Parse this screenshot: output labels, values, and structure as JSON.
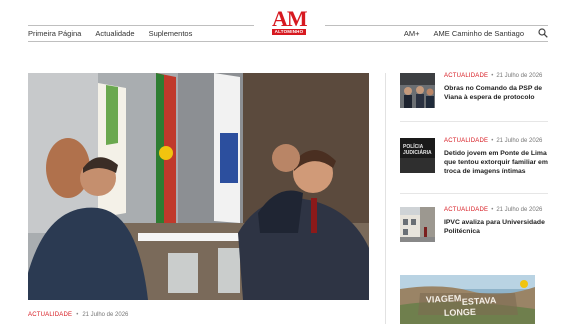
{
  "header": {
    "nav_left": [
      "Primeira Página",
      "Actualidade",
      "Suplementos"
    ],
    "nav_right": [
      "AM+",
      "AME Caminho de Santiago"
    ],
    "logo_text": "AM",
    "logo_sub": "ALTOMINHO",
    "search_icon": "search-icon"
  },
  "featured": {
    "category": "ACTUALIDADE",
    "separator": "•",
    "date": "21 Julho de 2026"
  },
  "side_items": [
    {
      "category": "ACTUALIDADE",
      "separator": "•",
      "date": "21 Julho de 2026",
      "title": "Obras no Comando da PSP de Viana à espera de protocolo"
    },
    {
      "category": "ACTUALIDADE",
      "separator": "•",
      "date": "21 Julho de 2026",
      "title": "Detido jovem em Ponte de Lima que tentou extorquir familiar em troca de imagens íntimas"
    },
    {
      "category": "ACTUALIDADE",
      "separator": "•",
      "date": "21 Julho de 2026",
      "title": "IPVC avaliza para Universidade Politécnica"
    }
  ],
  "colors": {
    "accent": "#d71920",
    "rule": "#bfbfbf"
  }
}
